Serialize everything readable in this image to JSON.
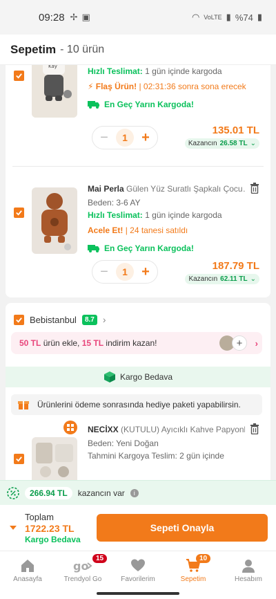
{
  "status_bar": {
    "time": "09:28",
    "battery": "%74",
    "network": "VoLTE"
  },
  "header": {
    "title": "Sepetim",
    "count": "- 10 ürün"
  },
  "items": [
    {
      "fast_label": "Hızlı Teslimat:",
      "fast_text": "1 gün içinde kargoda",
      "flash_label": "⚡ Flaş Ürün!",
      "flash_text": "| 02:31:36 sonra sona erecek",
      "cargo": "En Geç Yarın Kargoda!",
      "qty": "1",
      "price": "135.01 TL",
      "earn_label": "Kazancın",
      "earn_amount": "26.58 TL"
    },
    {
      "brand": "Mai Perla",
      "name": "Gülen Yüz Suratlı Şapkalı Çocu…",
      "size": "Beden: 3-6 AY",
      "fast_label": "Hızlı Teslimat:",
      "fast_text": "1 gün içinde kargoda",
      "urgent_label": "Acele Et!",
      "urgent_text": "| 24 tanesi satıldı",
      "cargo": "En Geç Yarın Kargoda!",
      "qty": "1",
      "price": "187.79 TL",
      "earn_label": "Kazancın",
      "earn_amount": "62.11 TL"
    }
  ],
  "seller": {
    "name": "Bebistanbul",
    "rating": "8.7",
    "promo_amount": "50 TL",
    "promo_text1": "ürün ekle,",
    "promo_discount": "15 TL",
    "promo_text2": "indirim kazan!",
    "free_shipping": "Kargo Bedava",
    "gift_text": "Ürünlerini ödeme sonrasında hediye paketi yapabilirsin."
  },
  "item3": {
    "brand": "NECİXX",
    "name": "(KUTULU) Ayıcıklı Kahve Papyonl…",
    "size": "Beden: Yeni Doğan",
    "delivery": "Tahmini Kargoya Teslim: 2 gün içinde"
  },
  "earn_strip": {
    "amount": "266.94 TL",
    "text": "kazancın var"
  },
  "total": {
    "label": "Toplam",
    "amount": "1722.23 TL",
    "shipping": "Kargo Bedava",
    "confirm": "Sepeti Onayla"
  },
  "nav": [
    {
      "label": "Anasayfa"
    },
    {
      "label": "Trendyol Go",
      "badge": "15"
    },
    {
      "label": "Favorilerim"
    },
    {
      "label": "Sepetim",
      "badge": "10"
    },
    {
      "label": "Hesabım"
    }
  ],
  "colors": {
    "accent": "#f27a1a",
    "green": "#0bc15c",
    "pink": "#e8457b"
  }
}
